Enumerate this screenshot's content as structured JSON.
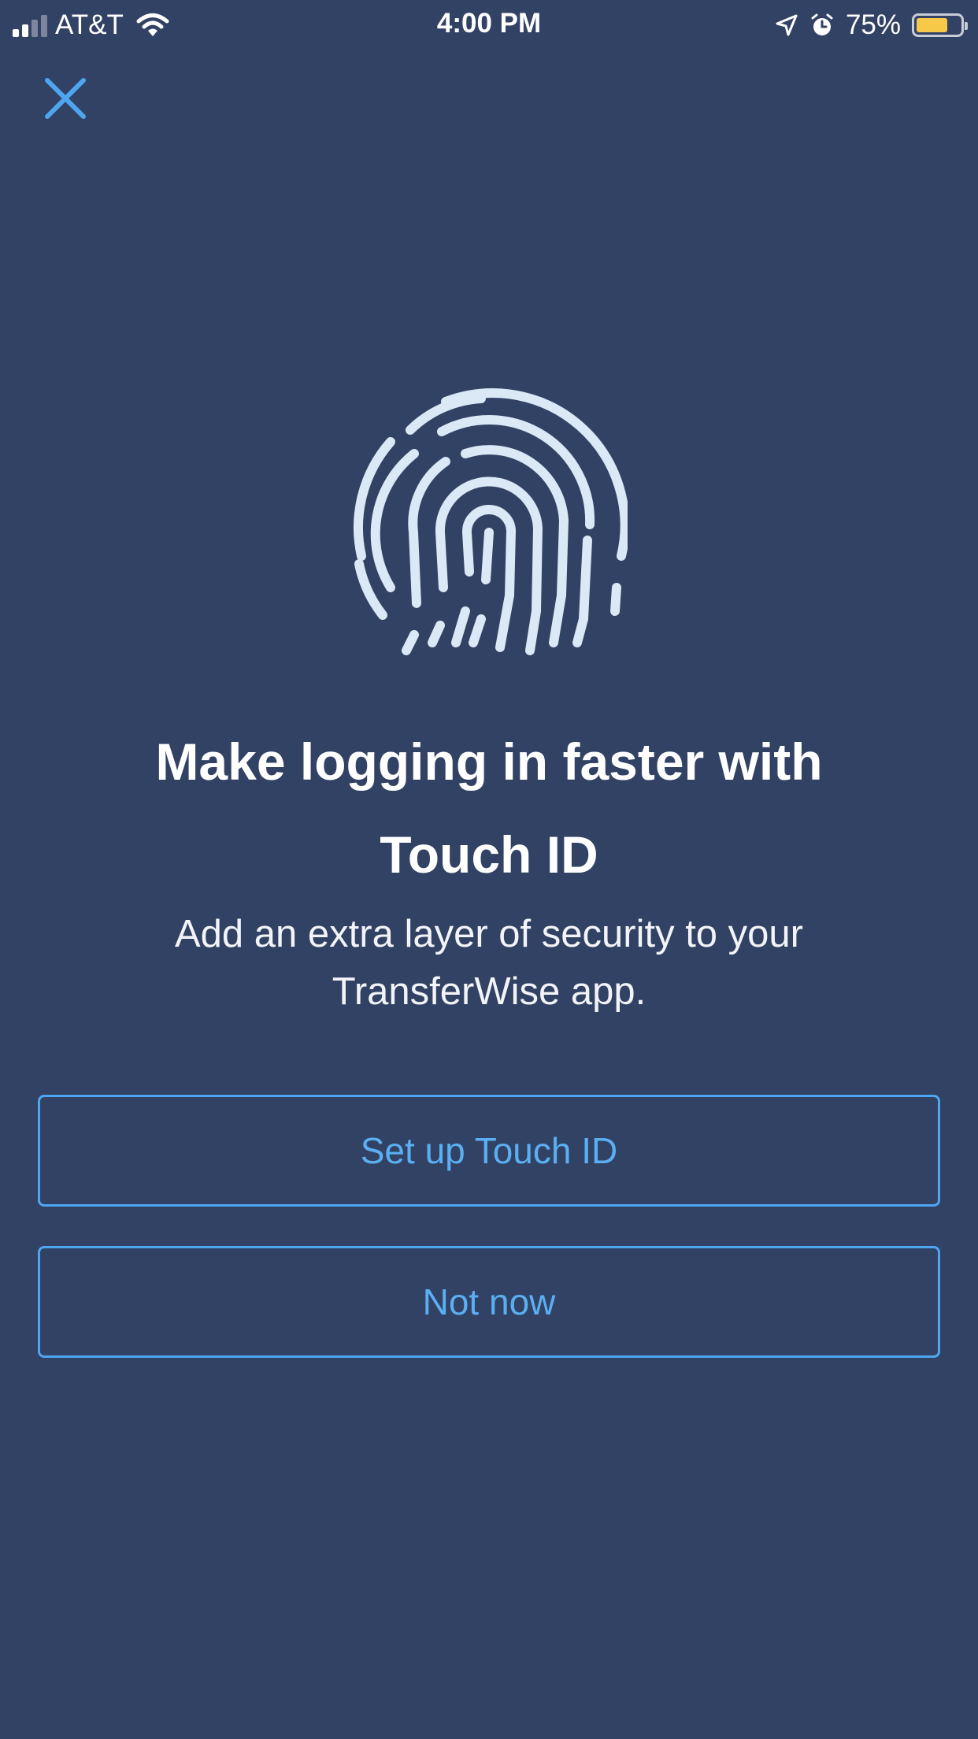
{
  "status_bar": {
    "carrier": "AT&T",
    "time": "4:00 PM",
    "battery_percent": "75%",
    "battery_level": 0.75,
    "signal_bars_filled": 2,
    "signal_bars_total": 4,
    "icons": [
      "signal-icon",
      "wifi-icon",
      "location-arrow-icon",
      "alarm-icon",
      "battery-icon"
    ]
  },
  "header": {
    "close_icon": "close-icon"
  },
  "hero": {
    "icon": "fingerprint-icon"
  },
  "content": {
    "title": "Make logging in faster with Touch ID",
    "subtitle": "Add an extra layer of security to your TransferWise app."
  },
  "actions": {
    "setup_label": "Set up Touch ID",
    "not_now_label": "Not now"
  },
  "colors": {
    "background": "#324264",
    "accent": "#4ea6f0",
    "text": "#ffffff",
    "battery": "#f7c948",
    "fingerprint": "#dbe8f5"
  }
}
